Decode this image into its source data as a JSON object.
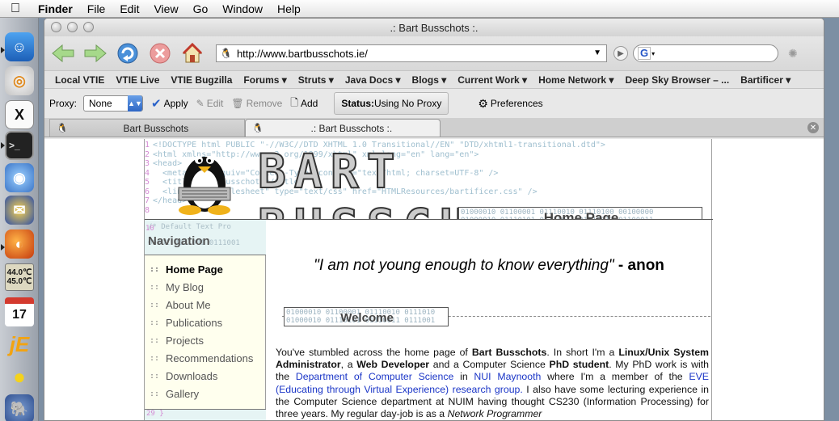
{
  "menubar": {
    "app": "Finder",
    "items": [
      "File",
      "Edit",
      "View",
      "Go",
      "Window",
      "Help"
    ]
  },
  "dock": {
    "temps": [
      "44.0℃",
      "45.0℃"
    ],
    "calendar_day": "17"
  },
  "window": {
    "title": ".: Bart Busschots :."
  },
  "navbar": {
    "url": "http://www.bartbusschots.ie/",
    "search_engine": "G"
  },
  "bookmarks": [
    {
      "label": "Local VTIE"
    },
    {
      "label": "VTIE Live"
    },
    {
      "label": "VTIE Bugzilla"
    },
    {
      "label": "Forums ▾"
    },
    {
      "label": "Struts ▾"
    },
    {
      "label": "Java Docs ▾"
    },
    {
      "label": "Blogs ▾"
    },
    {
      "label": "Current Work ▾"
    },
    {
      "label": "Home Network ▾"
    },
    {
      "label": "Deep Sky Browser – ..."
    },
    {
      "label": "Bartificer ▾"
    }
  ],
  "proxybar": {
    "label": "Proxy:",
    "selected": "None",
    "apply": "Apply",
    "edit": "Edit",
    "remove": "Remove",
    "add": "Add",
    "status_label": "Status:",
    "status_value": "Using No Proxy",
    "preferences": "Preferences"
  },
  "tabs": [
    {
      "label": "Bart Busschots"
    },
    {
      "label": ".: Bart Busschots :."
    }
  ],
  "page": {
    "logo": "BART BUSSCHOTS",
    "code_lines": [
      "<!DOCTYPE html PUBLIC \"-//W3C//DTD XHTML 1.0 Transitional//EN\" \"DTD/xhtml1-transitional.dtd\">",
      "<html xmlns=\"http://www.w3.org/1999/xhtml\" xml:lang=\"en\" lang=\"en\">",
      "<head>",
      "  <meta http-equiv=\"Content-Type\" content=\"text/html; charset=UTF-8\" />",
      "  <title>Bart Busschots</title>",
      "  <link rel=\"stylesheet\" type=\"text/css\" href=\"HTMLResources/bartificer.css\" />",
      "</head>",
      ""
    ],
    "header_title": "Home Page",
    "header_binary": "01000010 01100001 01110010 01110100 00100000\n01000010 01110101 01110011 01110011 01100011",
    "nav_code": "/* Default Text Pro",
    "nav_binary": "\n\n00001 0111001 0111001",
    "nav_title": "Navigation",
    "nav_items": [
      {
        "label": "Home Page"
      },
      {
        "label": "My Blog"
      },
      {
        "label": "About Me"
      },
      {
        "label": "Publications"
      },
      {
        "label": "Projects"
      },
      {
        "label": "Recommendations"
      },
      {
        "label": "Downloads"
      },
      {
        "label": "Gallery"
      }
    ],
    "nav_footer": "29  }",
    "quote_text": "\"I am not young enough to know everything\"",
    "quote_author": "- anon",
    "welcome_title": "Welcome",
    "welcome_binary": "01000010 01100001 01110010 0111010\n01000010 01110101 01110011 0111001",
    "intro": {
      "t1": "You've stumbled across the home page of ",
      "name": "Bart Busschots",
      "t2": ". In short I'm a ",
      "role1": "Linux/Unix System Administrator",
      "t3": ", a ",
      "role2": "Web Developer",
      "t4": " and a Computer Science ",
      "role3": "PhD student",
      "t5": ". My PhD work is with the ",
      "link1": "Department of Computer Science",
      "t6": " in ",
      "link2": "NUI Maynooth",
      "t7": " where I'm a member of the ",
      "link3": "EVE (Educating through Virtual Experience) research group.",
      "t8": " I also have some lecturing experience in the Computer Science department at NUIM having thought CS230 (Information Processing) for three years. My regular day-job is as a ",
      "job": "Network Programmer"
    }
  },
  "colors": {
    "link": "#1a35c7",
    "sidebar_bg": "#ffffee",
    "code_tint": "#9fbfcf"
  }
}
